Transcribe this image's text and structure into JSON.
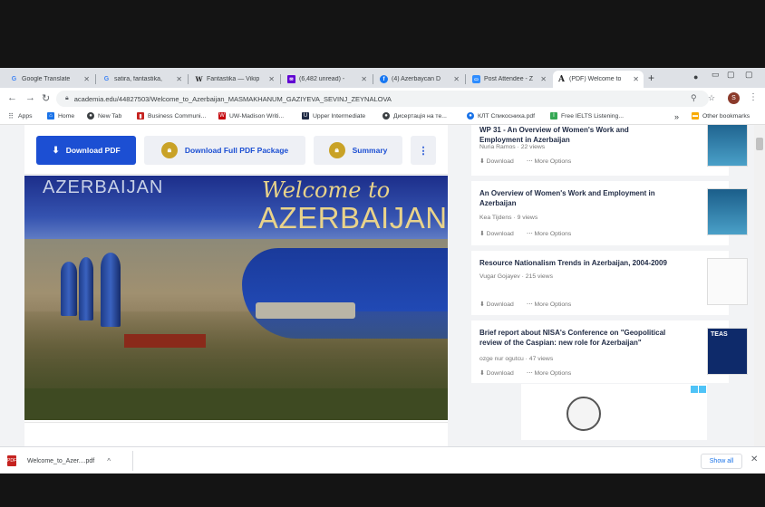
{
  "tabs": [
    {
      "title": "Google Translate",
      "icon": "translate-icon",
      "color": "#4285f4"
    },
    {
      "title": "satira, fantastika, ",
      "icon": "google-icon",
      "color": "#4285f4"
    },
    {
      "title": "Fantastika — Vikip",
      "icon": "wikipedia-icon",
      "color": "#202122"
    },
    {
      "title": "(6,482 unread) - ",
      "icon": "yahoo-mail-icon",
      "color": "#6001d2"
    },
    {
      "title": "(4) Azerbaycan D",
      "icon": "facebook-icon",
      "color": "#1877f2"
    },
    {
      "title": "Post Attendee - Z",
      "icon": "zoom-icon",
      "color": "#2d8cff"
    },
    {
      "title": "(PDF) Welcome to",
      "icon": "academia-icon",
      "color": "#202122"
    }
  ],
  "url": "academia.edu/44827503/Welcome_to_Azerbaijan_MASMAKHANUM_GAZIYEVA_SEVINJ_ZEYNALOVA",
  "avatar_letter": "S",
  "bookmarks": [
    {
      "label": "Apps",
      "icon": "apps-icon",
      "color": "#5f6368"
    },
    {
      "label": "Home",
      "icon": "home-icon",
      "color": "#1a73e8"
    },
    {
      "label": "New Tab",
      "icon": "globe-icon",
      "color": "#3c4043"
    },
    {
      "label": "Business Communi...",
      "icon": "bookmark-icon",
      "color": "#c5221f"
    },
    {
      "label": "UW-Madison Writi...",
      "icon": "uw-icon",
      "color": "#c5050c"
    },
    {
      "label": "Upper Intermediate",
      "icon": "bookmark-icon",
      "color": "#1f2a44"
    },
    {
      "label": "Дисертація на те...",
      "icon": "globe-icon",
      "color": "#3c4043"
    },
    {
      "label": "КЛТ Спикосниха.pdf",
      "icon": "pdf-icon",
      "color": "#1a73e8"
    },
    {
      "label": "Free IELTS Listening...",
      "icon": "ielts-icon",
      "color": "#34a853"
    },
    {
      "label": "Other bookmarks",
      "icon": "folder-icon",
      "color": "#f9ab00"
    }
  ],
  "bookmarks_more": "»",
  "actions": {
    "download_pdf": "Download PDF",
    "download_full": "Download Full PDF Package",
    "summary": "Summary",
    "more": "⋮"
  },
  "hero": {
    "left_text": "AZERBAIJAN",
    "welcome": "Welcome to",
    "big": "AZERBAIJAN"
  },
  "sidebar": [
    {
      "title": "WP 31 - An Overview of Women's Work and Employment in Azerbaijan",
      "author": "Nuria Ramos",
      "views": "22 views",
      "download": "Download",
      "more": "More Options"
    },
    {
      "title": "An Overview of Women's Work and Employment in Azerbaijan",
      "author": "Kea Tijdens",
      "views": "9 views",
      "download": "Download",
      "more": "More Options"
    },
    {
      "title": "Resource Nationalism Trends in Azerbaijan, 2004-2009",
      "author": "Vugar Gojayev",
      "views": "215 views",
      "download": "Download",
      "more": "More Options"
    },
    {
      "title": "Brief report about NISA's Conference on \"Geopolitical review of the Caspian: new role for Azerbaijan\"",
      "author": "ozge nur ogutcu",
      "views": "47 views",
      "download": "Download",
      "more": "More Options"
    }
  ],
  "thumb_teas": "TEAS",
  "download_shelf": {
    "file": "Welcome_to_Azer....pdf",
    "show_all": "Show all"
  },
  "colors": {
    "primary_blue": "#1c4fd3",
    "lock_gold": "#c9a227",
    "gold_text": "#e9d38a"
  }
}
